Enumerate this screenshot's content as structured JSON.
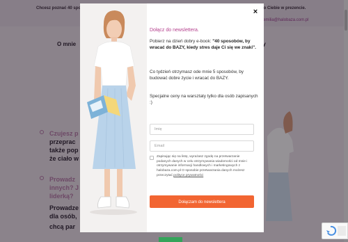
{
  "background": {
    "topbar_left": "Chcesz poznać 40 spo",
    "topbar_right": "do Ciebie w prezencie.",
    "topbar_email": "emilia@halobaza.com.pl",
    "nav_left": "O mnie",
    "nav_right": "rsztaty",
    "left_lines": [
      "Czujesz p",
      "przeprac",
      "także pop",
      "że ciało w"
    ],
    "left_lines_2": [
      "Prowadz",
      "innych? J",
      "liderką? ",
      "Prowadze",
      "dla osób,",
      "chcą par"
    ]
  },
  "popup": {
    "close_symbol": "×",
    "title": "Dołącz do newslettera.",
    "intro_pre": "Pobierz na dzień dobry e-book: ",
    "intro_bold": "\"40 sposobów, by wracać do BAZY, kiedy stres daje Ci się we znaki\".",
    "weekly": "Co tydzień otrzymasz ode mnie 5 sposobów, by budować dobre życie i wracać do BAZY.",
    "special": "Specjalne ceny na warsztaty tylko dla osób zapisanych :)",
    "name_placeholder": "Imię",
    "email_placeholder": "Email",
    "consent_text": "Zapisując się na listę, wyrażasz zgodę na przetwarzanie podanych danych w celu otrzymywania wiadomości od mnie i otrzymywanie informacji handlowych i marketingowych z halobaza.com.pl O sposobie przetwarzania danych możesz przeczytać ",
    "consent_link": "polityce prywatności",
    "submit_label": "Dołączam do newslettera"
  },
  "colors": {
    "accent": "#b5418e",
    "button": "#f26532",
    "overlay": "rgba(20,14,22,0.45)"
  }
}
